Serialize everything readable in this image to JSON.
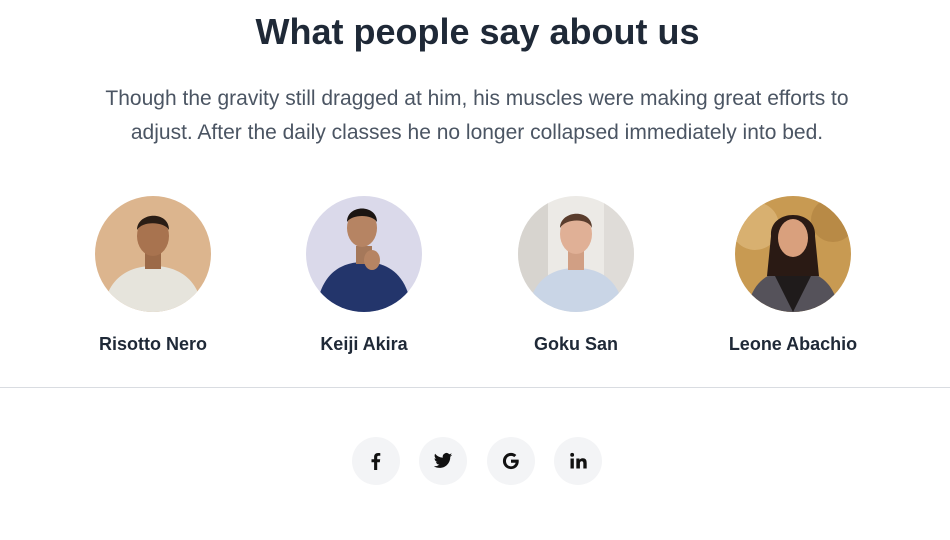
{
  "testimonials": {
    "title": "What people say about us",
    "description": "Though the gravity still dragged at him, his muscles were making great efforts to adjust. After the daily classes he no longer collapsed immediately into bed.",
    "people": [
      {
        "name": "Risotto Nero",
        "avatar": "person-avatar-photo"
      },
      {
        "name": "Keiji Akira",
        "avatar": "person-avatar-photo"
      },
      {
        "name": "Goku San",
        "avatar": "person-avatar-photo"
      },
      {
        "name": "Leone Abachio",
        "avatar": "person-avatar-photo"
      }
    ]
  },
  "footer": {
    "social_links": [
      {
        "icon": "facebook-icon"
      },
      {
        "icon": "twitter-icon"
      },
      {
        "icon": "google-icon"
      },
      {
        "icon": "linkedin-icon"
      }
    ]
  },
  "colors": {
    "heading": "#1f2937",
    "body_text": "#4b5563",
    "social_button_bg": "#f3f4f6",
    "divider": "#d9dce1"
  }
}
